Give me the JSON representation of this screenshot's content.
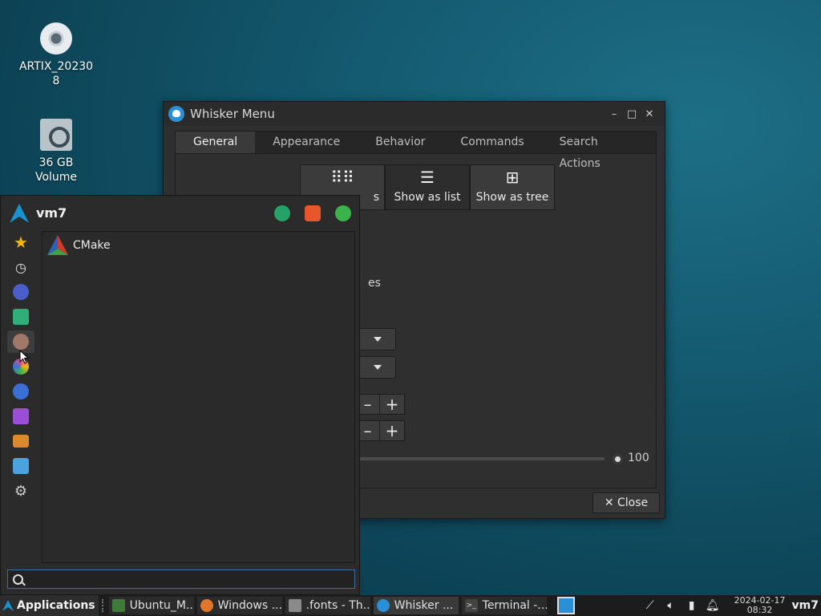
{
  "desktop": {
    "icons": [
      {
        "label": "ARTIX_20230\n8",
        "icon": "optical-disc-icon"
      },
      {
        "label": "36 GB\nVolume",
        "icon": "drive-icon"
      }
    ]
  },
  "settings_window": {
    "title": "Whisker Menu",
    "controls": {
      "minimize": "–",
      "maximize": "□",
      "close": "✕"
    },
    "tabs": [
      {
        "label": "General",
        "active": true
      },
      {
        "label": "Appearance"
      },
      {
        "label": "Behavior"
      },
      {
        "label": "Commands"
      },
      {
        "label": "Search Actions"
      }
    ],
    "view_mode": {
      "options": [
        {
          "label": "s",
          "icon": "grid-icon"
        },
        {
          "label": "Show as list",
          "icon": "list-icon",
          "active": true
        },
        {
          "label": "Show as tree",
          "icon": "tree-icon"
        }
      ]
    },
    "partial_text": "es",
    "slider_value": "100",
    "slider_level": 100,
    "close_label": "✕ Close"
  },
  "whisker_menu": {
    "username": "vm7",
    "header_buttons": [
      "settings-icon",
      "lock-screen-icon",
      "logout-icon"
    ],
    "categories": [
      {
        "name": "favorites",
        "color": "#f2b511"
      },
      {
        "name": "recently-used",
        "color": "#e8e8e8"
      },
      {
        "name": "all-applications",
        "color": "#4a5ec9"
      },
      {
        "name": "accessories",
        "color": "#2fae7a"
      },
      {
        "name": "development",
        "color": "#a0786a",
        "selected": true
      },
      {
        "name": "graphics",
        "color": "#e04f8a"
      },
      {
        "name": "internet",
        "color": "#3c6fd6"
      },
      {
        "name": "multimedia",
        "color": "#9b4fd6"
      },
      {
        "name": "office",
        "color": "#d98a2b"
      },
      {
        "name": "system",
        "color": "#4aa3df"
      },
      {
        "name": "settings",
        "color": "#cfcfcf"
      }
    ],
    "apps": [
      {
        "label": "CMake",
        "icon": "cmake-icon"
      }
    ],
    "search": {
      "value": "",
      "placeholder": ""
    }
  },
  "taskbar": {
    "applications_label": "Applications",
    "tasks": [
      {
        "label": "Ubuntu_M...",
        "icon": "virtualbox-icon",
        "color": "#3e7a3a"
      },
      {
        "label": "Windows ...",
        "icon": "firefox-icon",
        "color": "#e0762b"
      },
      {
        "label": ".fonts - Th...",
        "icon": "folder-icon",
        "color": "#8a8a8a"
      },
      {
        "label": "Whisker ...",
        "icon": "whisker-icon",
        "color": "#2a8fd6",
        "active": true
      },
      {
        "label": "Terminal -...",
        "icon": "terminal-icon",
        "color": "#444444"
      }
    ],
    "clock_date": "2024-02-17",
    "clock_time": "08:32",
    "user": "vm7"
  }
}
